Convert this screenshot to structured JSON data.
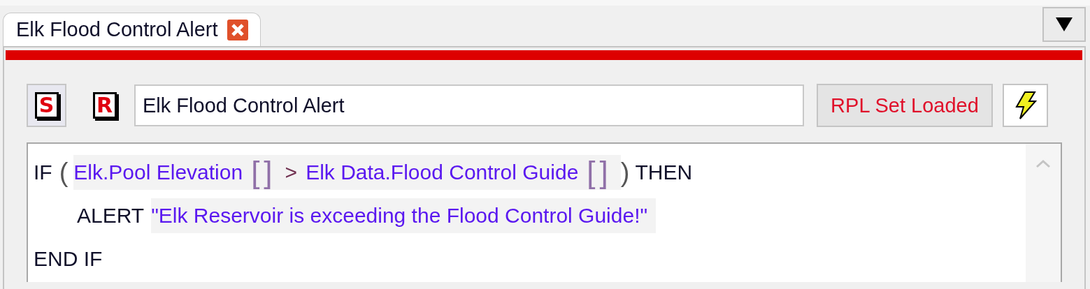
{
  "tabs": [
    {
      "label": "Elk Flood Control Alert",
      "selected": true
    }
  ],
  "toolbar": {
    "buttons": [
      {
        "label": "S",
        "selected": true
      },
      {
        "label": "R",
        "selected": false
      }
    ],
    "name_field": {
      "value": "Elk Flood Control Alert"
    },
    "status_button": "RPL Set Loaded"
  },
  "code_lines": [
    {
      "tokens": [
        {
          "kind": "keyword",
          "text": "IF"
        },
        {
          "kind": "paren",
          "text": "("
        },
        {
          "kind": "expr",
          "text": "Elk.Pool Elevation"
        },
        {
          "kind": "unit",
          "text": "[]"
        },
        {
          "kind": "operator",
          "text": ">"
        },
        {
          "kind": "expr",
          "text": "Elk Data.Flood Control Guide"
        },
        {
          "kind": "unit",
          "text": "[]"
        },
        {
          "kind": "paren",
          "text": ")"
        },
        {
          "kind": "keyword",
          "text": "THEN"
        }
      ],
      "children": [
        {
          "tokens": [
            {
              "kind": "keyword",
              "text": "ALERT"
            },
            {
              "kind": "string",
              "text": "\"Elk Reservoir is exceeding the Flood Control Guide!\""
            }
          ]
        }
      ]
    },
    {
      "tokens": [
        {
          "kind": "keyword",
          "text": "END IF"
        }
      ]
    }
  ]
}
